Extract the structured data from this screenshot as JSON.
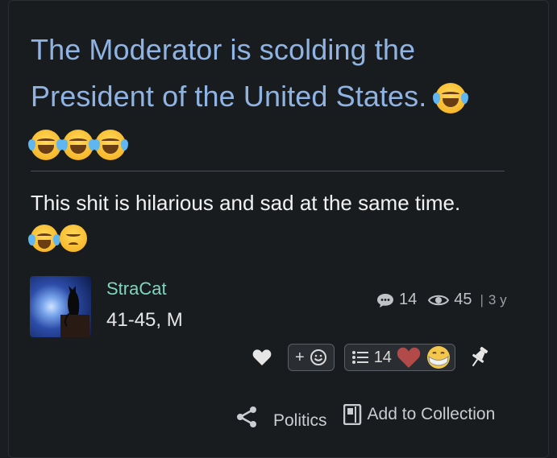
{
  "post": {
    "title": "The Moderator is scolding the President of the United States.",
    "body": "This shit is hilarious and sad at the same time."
  },
  "author": {
    "name": "StraCat",
    "age_sex": "41-45, M"
  },
  "stats": {
    "comments": "14",
    "views": "45",
    "age": "3 y"
  },
  "reactions": {
    "add_label": "+",
    "list_count": "14"
  },
  "footer": {
    "category": "Politics",
    "add_collection": "Add to Collection"
  },
  "colors": {
    "title": "#8fb4e3",
    "author": "#7fd6bf",
    "background": "#191c1f"
  },
  "icons": [
    "laughing-crying-emoji",
    "sad-emoji",
    "comment-icon",
    "eye-icon",
    "heart-icon",
    "smiley-add-icon",
    "list-icon",
    "pin-icon",
    "share-icon",
    "collection-icon"
  ]
}
